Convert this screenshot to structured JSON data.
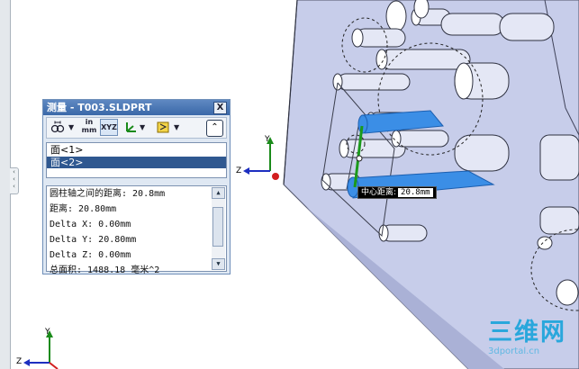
{
  "measure": {
    "title": "测量 - T003.SLDPRT",
    "close_label": "X",
    "toolbar": {
      "units_top": "in",
      "units_bottom": "mm",
      "xyz_label": "XYZ",
      "collapse_label": "⌃"
    },
    "selections": [
      "面<1>",
      "面<2>"
    ],
    "results": [
      "圆柱轴之间的距离:  20.8mm",
      "距离: 20.80mm",
      "Delta X: 0.00mm",
      "Delta Y: 20.80mm",
      "Delta Z: 0.00mm",
      "总面积: 1488.18 毫米^2"
    ]
  },
  "callout": {
    "label": "中心距离:",
    "value": "20.8mm"
  },
  "triad_main": {
    "y": "Y",
    "z": "Z"
  },
  "triad_corner": {
    "y": "Y",
    "z": "Z"
  },
  "watermark": {
    "text": "三维网",
    "url": "3dportal.cn"
  },
  "colors": {
    "selection_blue": "#3b8ee6",
    "model_face": "#c5cdeb",
    "panel_title": "#3a68a8"
  }
}
